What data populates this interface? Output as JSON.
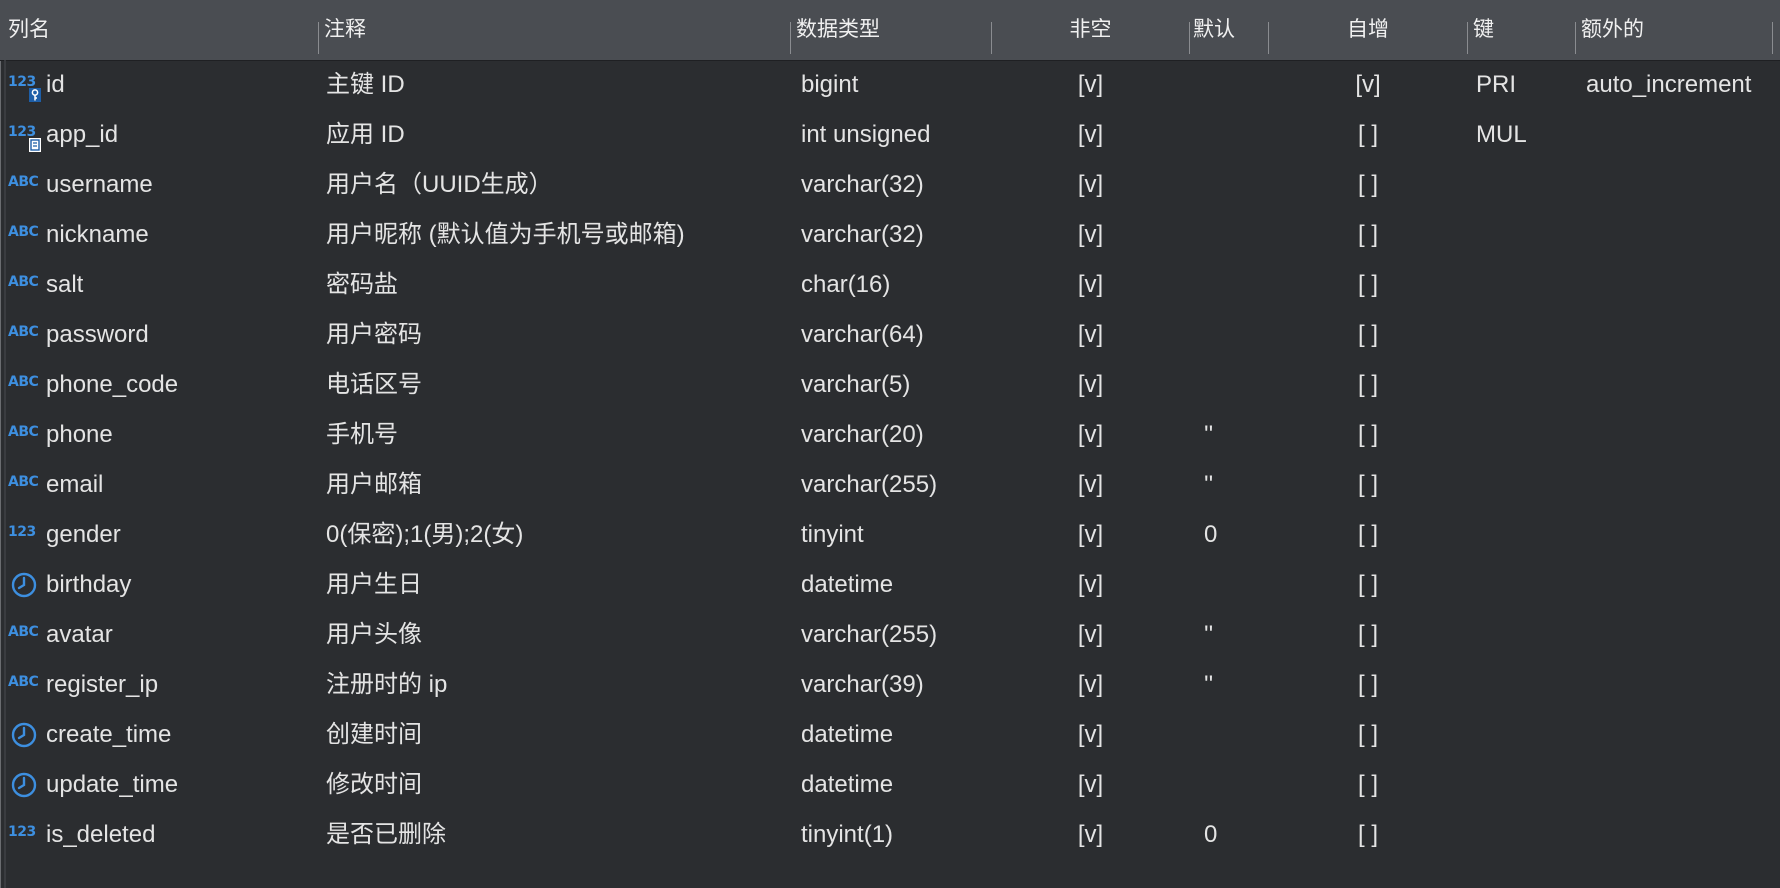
{
  "headers": {
    "name": "列名",
    "comment": "注释",
    "type": "数据类型",
    "notnull": "非空",
    "default": "默认",
    "autoinc": "自增",
    "key": "键",
    "extra": "额外的"
  },
  "rows": [
    {
      "icon": "123",
      "badge": "key",
      "name": "id",
      "comment": "主键 ID",
      "type": "bigint",
      "notnull": "[v]",
      "default": "",
      "autoinc": "[v]",
      "key": "PRI",
      "extra": "auto_increment"
    },
    {
      "icon": "123",
      "badge": "index",
      "name": "app_id",
      "comment": "应用 ID",
      "type": "int unsigned",
      "notnull": "[v]",
      "default": "",
      "autoinc": "[ ]",
      "key": "MUL",
      "extra": ""
    },
    {
      "icon": "ABC",
      "name": "username",
      "comment": "用户名（UUID生成）",
      "type": "varchar(32)",
      "notnull": "[v]",
      "default": "",
      "autoinc": "[ ]",
      "key": "",
      "extra": ""
    },
    {
      "icon": "ABC",
      "name": "nickname",
      "comment": "用户昵称 (默认值为手机号或邮箱)",
      "type": "varchar(32)",
      "notnull": "[v]",
      "default": "",
      "autoinc": "[ ]",
      "key": "",
      "extra": ""
    },
    {
      "icon": "ABC",
      "name": "salt",
      "comment": "密码盐",
      "type": "char(16)",
      "notnull": "[v]",
      "default": "",
      "autoinc": "[ ]",
      "key": "",
      "extra": ""
    },
    {
      "icon": "ABC",
      "name": "password",
      "comment": "用户密码",
      "type": "varchar(64)",
      "notnull": "[v]",
      "default": "",
      "autoinc": "[ ]",
      "key": "",
      "extra": ""
    },
    {
      "icon": "ABC",
      "name": "phone_code",
      "comment": "电话区号",
      "type": "varchar(5)",
      "notnull": "[v]",
      "default": "",
      "autoinc": "[ ]",
      "key": "",
      "extra": ""
    },
    {
      "icon": "ABC",
      "name": "phone",
      "comment": "手机号",
      "type": "varchar(20)",
      "notnull": "[v]",
      "default": "''",
      "autoinc": "[ ]",
      "key": "",
      "extra": ""
    },
    {
      "icon": "ABC",
      "name": "email",
      "comment": "用户邮箱",
      "type": "varchar(255)",
      "notnull": "[v]",
      "default": "''",
      "autoinc": "[ ]",
      "key": "",
      "extra": ""
    },
    {
      "icon": "123",
      "name": "gender",
      "comment": "0(保密);1(男);2(女)",
      "type": "tinyint",
      "notnull": "[v]",
      "default": "0",
      "autoinc": "[ ]",
      "key": "",
      "extra": ""
    },
    {
      "icon": "clock",
      "name": "birthday",
      "comment": "用户生日",
      "type": "datetime",
      "notnull": "[v]",
      "default": "",
      "autoinc": "[ ]",
      "key": "",
      "extra": ""
    },
    {
      "icon": "ABC",
      "name": "avatar",
      "comment": "用户头像",
      "type": "varchar(255)",
      "notnull": "[v]",
      "default": "''",
      "autoinc": "[ ]",
      "key": "",
      "extra": ""
    },
    {
      "icon": "ABC",
      "name": "register_ip",
      "comment": "注册时的 ip",
      "type": "varchar(39)",
      "notnull": "[v]",
      "default": "''",
      "autoinc": "[ ]",
      "key": "",
      "extra": ""
    },
    {
      "icon": "clock",
      "name": "create_time",
      "comment": "创建时间",
      "type": "datetime",
      "notnull": "[v]",
      "default": "",
      "autoinc": "[ ]",
      "key": "",
      "extra": ""
    },
    {
      "icon": "clock",
      "name": "update_time",
      "comment": "修改时间",
      "type": "datetime",
      "notnull": "[v]",
      "default": "",
      "autoinc": "[ ]",
      "key": "",
      "extra": ""
    },
    {
      "icon": "123",
      "name": "is_deleted",
      "comment": "是否已删除",
      "type": "tinyint(1)",
      "notnull": "[v]",
      "default": "0",
      "autoinc": "[ ]",
      "key": "",
      "extra": ""
    }
  ],
  "colors": {
    "background": "#2b2d30",
    "header": "#4a4d52",
    "icon_accent": "#3d8fe0",
    "text": "#e4e4e4"
  }
}
